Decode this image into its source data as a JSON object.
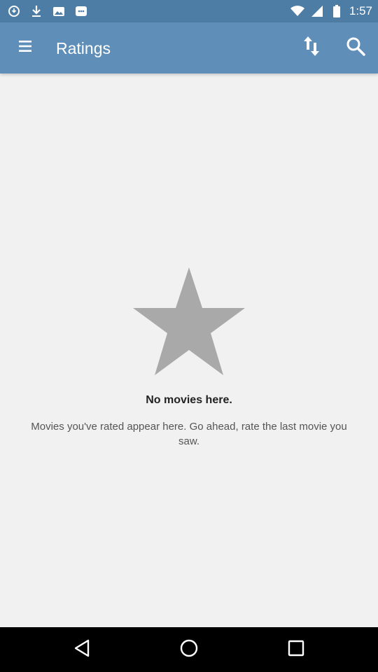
{
  "status_bar": {
    "time": "1:57",
    "icons": [
      "data-saver-icon",
      "download-icon",
      "photos-icon",
      "messaging-icon",
      "wifi-icon",
      "signal-icon",
      "battery-icon"
    ]
  },
  "app_bar": {
    "title": "Ratings",
    "colors": {
      "background": "#5f8fb9",
      "status_bar": "#4d7da4"
    },
    "actions": [
      "menu-icon",
      "sort-icon",
      "search-icon"
    ]
  },
  "empty_state": {
    "icon": "star-icon",
    "title": "No movies here.",
    "description": "Movies you've rated appear here. Go ahead, rate the last movie you saw."
  },
  "nav_bar": {
    "buttons": [
      "back-icon",
      "home-icon",
      "recents-icon"
    ]
  }
}
